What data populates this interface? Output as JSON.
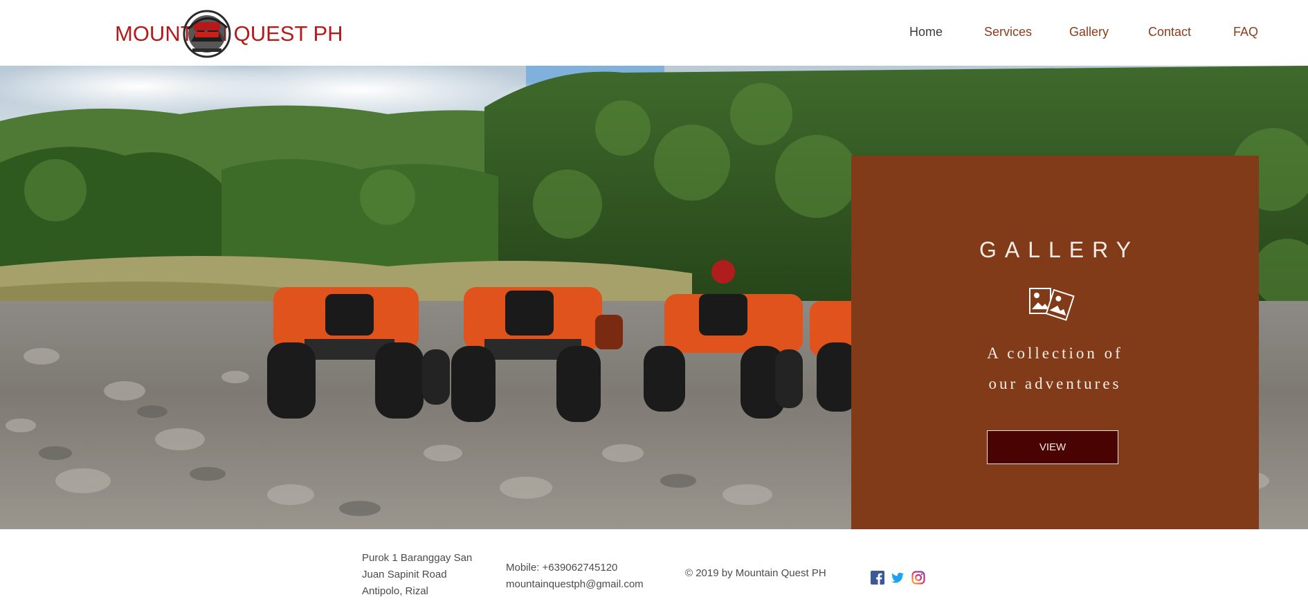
{
  "header": {
    "logo_text": "MOUNTAIN QUEST PH",
    "nav": [
      {
        "label": "Home",
        "active": true
      },
      {
        "label": "Services",
        "active": false
      },
      {
        "label": "Gallery",
        "active": false
      },
      {
        "label": "Contact",
        "active": false
      },
      {
        "label": "FAQ",
        "active": false
      }
    ]
  },
  "hero": {
    "gallery_title": "GALLERY",
    "gallery_icon": "photos-icon",
    "subtitle_line1": "A collection of",
    "subtitle_line2": "our adventures",
    "view_button": "VIEW"
  },
  "footer": {
    "address_line1": "Purok 1 Baranggay San",
    "address_line2": "Juan Sapinit Road",
    "address_line3": "Antipolo, Rizal",
    "mobile": "Mobile: +639062745120",
    "email": "mountainquestph@gmail.com",
    "copyright": "© 2019 by Mountain Quest PH",
    "social": [
      "facebook-icon",
      "twitter-icon",
      "instagram-icon"
    ]
  },
  "colors": {
    "brand_red": "#b5191a",
    "nav_brown": "#8a3c1b",
    "gallery_panel": "#813b19",
    "view_button_bg": "#4a0303"
  }
}
